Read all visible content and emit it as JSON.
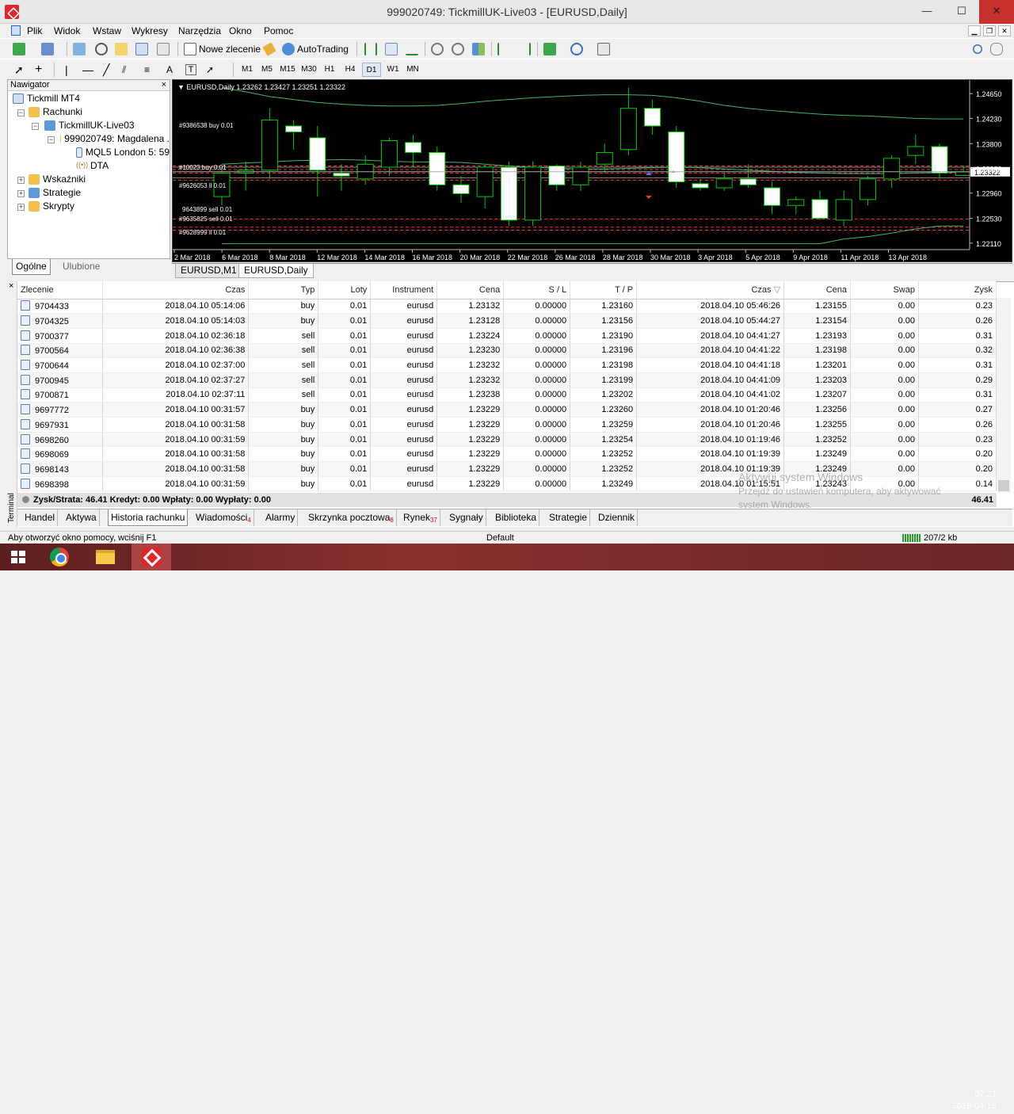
{
  "window": {
    "title": "999020749: TickmillUK-Live03 - [EURUSD,Daily]",
    "min": "—",
    "max": "☐",
    "close": "✕"
  },
  "menu": [
    "Plik",
    "Widok",
    "Wstaw",
    "Wykresy",
    "Narzędzia",
    "Okno",
    "Pomoc"
  ],
  "toolbar": {
    "new_order": "Nowe zlecenie",
    "autotrading": "AutoTrading",
    "timeframes": [
      "M1",
      "M5",
      "M15",
      "M30",
      "H1",
      "H4",
      "D1",
      "W1",
      "MN"
    ],
    "active_timeframe": "D1"
  },
  "navigator": {
    "title": "Nawigator",
    "close": "×",
    "items": [
      {
        "label": "Tickmill MT4",
        "icon": "terminal-icon"
      },
      {
        "label": "Rachunki",
        "icon": "accounts-icon"
      },
      {
        "label": "TickmillUK-Live03",
        "icon": "server-icon"
      },
      {
        "label": "999020749: Magdalena .",
        "icon": "account-icon"
      },
      {
        "label": "MQL5 London 5: 59",
        "icon": "mql5-icon"
      },
      {
        "label": "DTA",
        "icon": "dta-icon"
      },
      {
        "label": "Wskaźniki",
        "icon": "indicators-icon"
      },
      {
        "label": "Strategie",
        "icon": "experts-icon"
      },
      {
        "label": "Skrypty",
        "icon": "scripts-icon"
      }
    ],
    "tabs": [
      "Ogólne",
      "Ulubione"
    ]
  },
  "chart": {
    "header": "EURUSD,Daily  1.23262 1.23427 1.23251 1.23322",
    "current_price": "1.23322",
    "order_labels": [
      "#9386538 buy 0.01",
      "#10023 buy 0.01",
      "#9626053 ll 0.01",
      "9643899 sell 0.01",
      "#9635825 sell 0.01",
      "#9628999 ll 0.01"
    ],
    "tabs": [
      "EURUSD,M1",
      "EURUSD,Daily"
    ],
    "active_tab": "EURUSD,Daily"
  },
  "chart_data": {
    "type": "candlestick",
    "symbol": "EURUSD",
    "timeframe": "Daily",
    "y_ticks": [
      "1.24650",
      "1.24230",
      "1.23800",
      "1.23380",
      "1.22960",
      "1.22530",
      "1.22110"
    ],
    "ylim": [
      1.22,
      1.248
    ],
    "x_ticks": [
      "2 Mar 2018",
      "6 Mar 2018",
      "8 Mar 2018",
      "12 Mar 2018",
      "14 Mar 2018",
      "16 Mar 2018",
      "20 Mar 2018",
      "22 Mar 2018",
      "26 Mar 2018",
      "28 Mar 2018",
      "30 Mar 2018",
      "3 Apr 2018",
      "5 Apr 2018",
      "9 Apr 2018",
      "11 Apr 2018",
      "13 Apr 2018"
    ],
    "candles": [
      {
        "o": 1.229,
        "h": 1.234,
        "l": 1.2275,
        "c": 1.233
      },
      {
        "o": 1.233,
        "h": 1.235,
        "l": 1.23,
        "c": 1.2335
      },
      {
        "o": 1.2335,
        "h": 1.244,
        "l": 1.232,
        "c": 1.242
      },
      {
        "o": 1.241,
        "h": 1.242,
        "l": 1.237,
        "c": 1.24
      },
      {
        "o": 1.239,
        "h": 1.241,
        "l": 1.229,
        "c": 1.2335
      },
      {
        "o": 1.233,
        "h": 1.2345,
        "l": 1.23,
        "c": 1.2325
      },
      {
        "o": 1.232,
        "h": 1.236,
        "l": 1.231,
        "c": 1.2345
      },
      {
        "o": 1.234,
        "h": 1.239,
        "l": 1.2325,
        "c": 1.2385
      },
      {
        "o": 1.2382,
        "h": 1.2395,
        "l": 1.234,
        "c": 1.2365
      },
      {
        "o": 1.2365,
        "h": 1.2375,
        "l": 1.23,
        "c": 1.231
      },
      {
        "o": 1.231,
        "h": 1.2325,
        "l": 1.228,
        "c": 1.2295
      },
      {
        "o": 1.229,
        "h": 1.2345,
        "l": 1.227,
        "c": 1.234
      },
      {
        "o": 1.234,
        "h": 1.235,
        "l": 1.224,
        "c": 1.225
      },
      {
        "o": 1.225,
        "h": 1.235,
        "l": 1.224,
        "c": 1.234
      },
      {
        "o": 1.2342,
        "h": 1.2345,
        "l": 1.23,
        "c": 1.231
      },
      {
        "o": 1.231,
        "h": 1.235,
        "l": 1.23,
        "c": 1.234
      },
      {
        "o": 1.2345,
        "h": 1.238,
        "l": 1.233,
        "c": 1.2365
      },
      {
        "o": 1.237,
        "h": 1.2475,
        "l": 1.236,
        "c": 1.244
      },
      {
        "o": 1.244,
        "h": 1.2455,
        "l": 1.2395,
        "c": 1.241
      },
      {
        "o": 1.24,
        "h": 1.241,
        "l": 1.2305,
        "c": 1.2315
      },
      {
        "o": 1.2312,
        "h": 1.232,
        "l": 1.23,
        "c": 1.2305
      },
      {
        "o": 1.2305,
        "h": 1.233,
        "l": 1.23,
        "c": 1.232
      },
      {
        "o": 1.232,
        "h": 1.2345,
        "l": 1.2305,
        "c": 1.231
      },
      {
        "o": 1.2305,
        "h": 1.2315,
        "l": 1.226,
        "c": 1.2275
      },
      {
        "o": 1.2275,
        "h": 1.229,
        "l": 1.226,
        "c": 1.2285
      },
      {
        "o": 1.2285,
        "h": 1.23,
        "l": 1.225,
        "c": 1.2253
      },
      {
        "o": 1.225,
        "h": 1.23,
        "l": 1.224,
        "c": 1.2285
      },
      {
        "o": 1.2285,
        "h": 1.2325,
        "l": 1.2275,
        "c": 1.232
      },
      {
        "o": 1.232,
        "h": 1.236,
        "l": 1.2305,
        "c": 1.2355
      },
      {
        "o": 1.236,
        "h": 1.2395,
        "l": 1.2345,
        "c": 1.2375
      },
      {
        "o": 1.2375,
        "h": 1.238,
        "l": 1.232,
        "c": 1.233
      },
      {
        "o": 1.2326,
        "h": 1.2343,
        "l": 1.2325,
        "c": 1.2332
      }
    ],
    "colors": {
      "bull": "#000000",
      "bear": "#ffffff",
      "wick": "#00cc00",
      "ma": "#3cb371"
    }
  },
  "terminal": {
    "label": "Terminal",
    "close": "×",
    "columns": [
      "Zlecenie",
      "Czas",
      "Typ",
      "Loty",
      "Instrument",
      "Cena",
      "S / L",
      "T / P",
      "Czas",
      "Cena",
      "Swap",
      "Zysk"
    ],
    "rows": [
      [
        "9704433",
        "2018.04.10 05:14:06",
        "buy",
        "0.01",
        "eurusd",
        "1.23132",
        "0.00000",
        "1.23160",
        "2018.04.10 05:46:26",
        "1.23155",
        "0.00",
        "0.23"
      ],
      [
        "9704325",
        "2018.04.10 05:14:03",
        "buy",
        "0.01",
        "eurusd",
        "1.23128",
        "0.00000",
        "1.23156",
        "2018.04.10 05:44:27",
        "1.23154",
        "0.00",
        "0.26"
      ],
      [
        "9700377",
        "2018.04.10 02:36:18",
        "sell",
        "0.01",
        "eurusd",
        "1.23224",
        "0.00000",
        "1.23190",
        "2018.04.10 04:41:27",
        "1.23193",
        "0.00",
        "0.31"
      ],
      [
        "9700564",
        "2018.04.10 02:36:38",
        "sell",
        "0.01",
        "eurusd",
        "1.23230",
        "0.00000",
        "1.23196",
        "2018.04.10 04:41:22",
        "1.23198",
        "0.00",
        "0.32"
      ],
      [
        "9700644",
        "2018.04.10 02:37:00",
        "sell",
        "0.01",
        "eurusd",
        "1.23232",
        "0.00000",
        "1.23198",
        "2018.04.10 04:41:18",
        "1.23201",
        "0.00",
        "0.31"
      ],
      [
        "9700945",
        "2018.04.10 02:37:27",
        "sell",
        "0.01",
        "eurusd",
        "1.23232",
        "0.00000",
        "1.23199",
        "2018.04.10 04:41:09",
        "1.23203",
        "0.00",
        "0.29"
      ],
      [
        "9700871",
        "2018.04.10 02:37:11",
        "sell",
        "0.01",
        "eurusd",
        "1.23238",
        "0.00000",
        "1.23202",
        "2018.04.10 04:41:02",
        "1.23207",
        "0.00",
        "0.31"
      ],
      [
        "9697772",
        "2018.04.10 00:31:57",
        "buy",
        "0.01",
        "eurusd",
        "1.23229",
        "0.00000",
        "1.23260",
        "2018.04.10 01:20:46",
        "1.23256",
        "0.00",
        "0.27"
      ],
      [
        "9697931",
        "2018.04.10 00:31:58",
        "buy",
        "0.01",
        "eurusd",
        "1.23229",
        "0.00000",
        "1.23259",
        "2018.04.10 01:20:46",
        "1.23255",
        "0.00",
        "0.26"
      ],
      [
        "9698260",
        "2018.04.10 00:31:59",
        "buy",
        "0.01",
        "eurusd",
        "1.23229",
        "0.00000",
        "1.23254",
        "2018.04.10 01:19:46",
        "1.23252",
        "0.00",
        "0.23"
      ],
      [
        "9698069",
        "2018.04.10 00:31:58",
        "buy",
        "0.01",
        "eurusd",
        "1.23229",
        "0.00000",
        "1.23252",
        "2018.04.10 01:19:39",
        "1.23249",
        "0.00",
        "0.20"
      ],
      [
        "9698143",
        "2018.04.10 00:31:58",
        "buy",
        "0.01",
        "eurusd",
        "1.23229",
        "0.00000",
        "1.23252",
        "2018.04.10 01:19:39",
        "1.23249",
        "0.00",
        "0.20"
      ],
      [
        "9698398",
        "2018.04.10 00:31:59",
        "buy",
        "0.01",
        "eurusd",
        "1.23229",
        "0.00000",
        "1.23249",
        "2018.04.10 01:15:51",
        "1.23243",
        "0.00",
        "0.14"
      ]
    ],
    "summary": "Zysk/Strata: 46.41  Kredyt: 0.00  Wpłaty: 0.00  Wypłaty: 0.00",
    "total": "46.41",
    "tabs": [
      {
        "label": "Handel",
        "badge": ""
      },
      {
        "label": "Aktywa",
        "badge": ""
      },
      {
        "label": "Historia rachunku",
        "badge": ""
      },
      {
        "label": "Wiadomości",
        "badge": "4"
      },
      {
        "label": "Alarmy",
        "badge": ""
      },
      {
        "label": "Skrzynka pocztowa",
        "badge": "8"
      },
      {
        "label": "Rynek",
        "badge": "37"
      },
      {
        "label": "Sygnały",
        "badge": ""
      },
      {
        "label": "Biblioteka",
        "badge": ""
      },
      {
        "label": "Strategie",
        "badge": ""
      },
      {
        "label": "Dziennik",
        "badge": ""
      }
    ],
    "active_tab": "Historia rachunku"
  },
  "watermark": {
    "line1": "Aktywuj system Windows",
    "line2": "Przejdź do ustawień komputera, aby aktywować",
    "line3": "system Windows."
  },
  "status": {
    "help": "Aby otworzyć okno pomocy, wciśnij F1",
    "profile": "Default",
    "traffic": "207/2 kb"
  },
  "tray": {
    "time": "07:21",
    "date": "2018-04-16"
  }
}
